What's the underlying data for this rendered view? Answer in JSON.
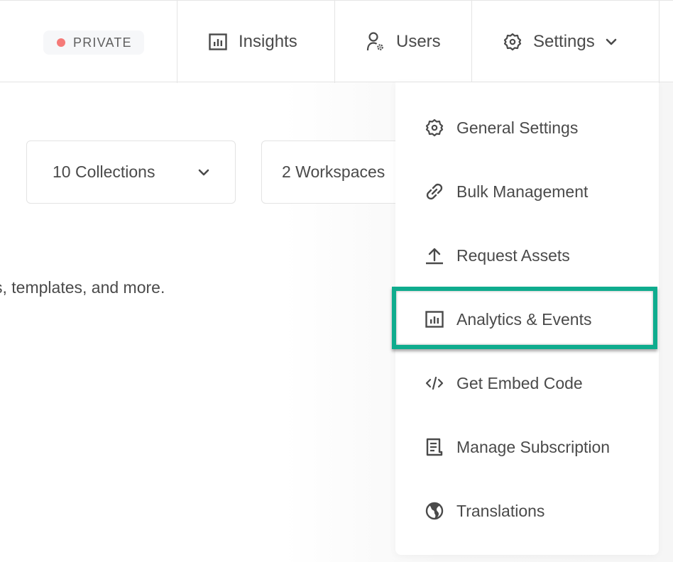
{
  "header": {
    "privacy_badge": "PRIVATE",
    "nav": [
      {
        "label": "Insights",
        "icon": "bar-chart-icon"
      },
      {
        "label": "Users",
        "icon": "user-gear-icon"
      },
      {
        "label": "Settings",
        "icon": "gear-icon",
        "has_dropdown": true
      }
    ]
  },
  "filters": {
    "collections": "10 Collections",
    "workspaces": "2 Workspaces"
  },
  "content": {
    "description_fragment": "s, templates, and more."
  },
  "settings_menu": {
    "items": [
      {
        "label": "General Settings",
        "icon": "gear-icon"
      },
      {
        "label": "Bulk Management",
        "icon": "link-icon"
      },
      {
        "label": "Request Assets",
        "icon": "upload-icon"
      },
      {
        "label": "Analytics & Events",
        "icon": "bar-chart-icon",
        "highlighted": true
      },
      {
        "label": "Get Embed Code",
        "icon": "code-icon"
      },
      {
        "label": "Manage Subscription",
        "icon": "receipt-icon"
      },
      {
        "label": "Translations",
        "icon": "globe-icon"
      }
    ]
  },
  "colors": {
    "highlight": "#0fac8e",
    "badge_dot": "#f57a78",
    "text": "#4a4a4a"
  }
}
